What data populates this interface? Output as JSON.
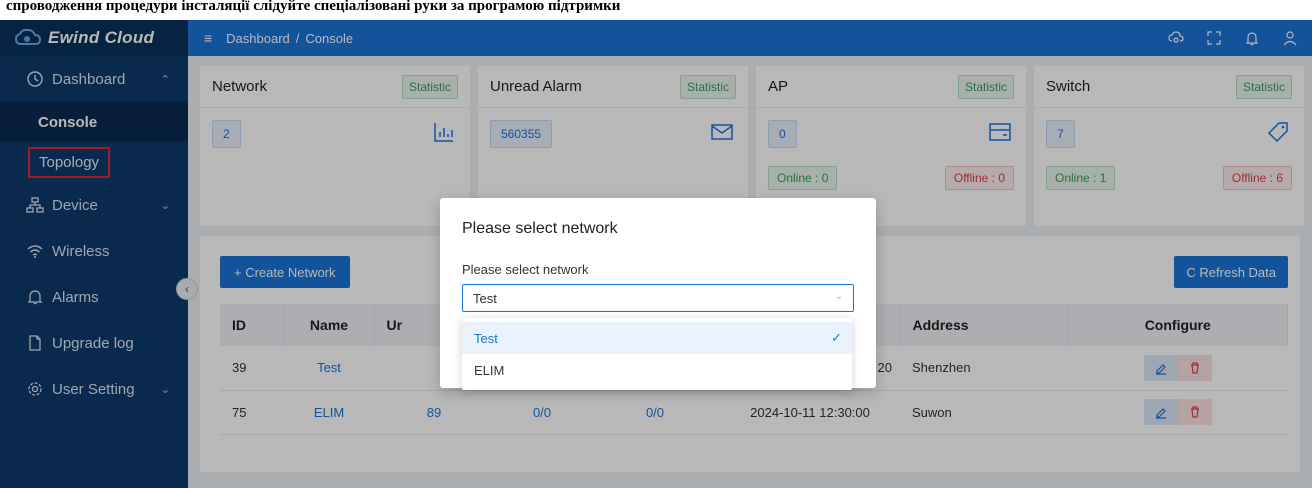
{
  "caption": "спроводження процедури інсталяції слідуйте спеціалізовані руки за програмою підтримки",
  "brand": {
    "name": "Ewind Cloud",
    "accent": "#1a73d9",
    "sidebar_bg": "#0d3a6b"
  },
  "breadcrumb": {
    "root": "Dashboard",
    "sep": "/",
    "current": "Console"
  },
  "sidebar": {
    "dashboard": "Dashboard",
    "console": "Console",
    "topology": "Topology",
    "device": "Device",
    "wireless": "Wireless",
    "alarms": "Alarms",
    "upgrade_log": "Upgrade log",
    "user_setting": "User Setting"
  },
  "cards": [
    {
      "title": "Network",
      "badge": "Statistic",
      "value": "2"
    },
    {
      "title": "Unread Alarm",
      "badge": "Statistic",
      "value": "560355"
    },
    {
      "title": "AP",
      "badge": "Statistic",
      "value": "0",
      "online": "Online : 0",
      "offline": "Offline : 0"
    },
    {
      "title": "Switch",
      "badge": "Statistic",
      "value": "7",
      "online": "Online : 1",
      "offline": "Offline : 6"
    }
  ],
  "toolbar": {
    "create": "+ Create Network",
    "refresh": "C Refresh Data"
  },
  "table": {
    "headers": {
      "id": "ID",
      "name": "Name",
      "unread": "Ur",
      "address": "Address",
      "configure": "Configure"
    },
    "rows": [
      {
        "id": "39",
        "name": "Test",
        "date_tail": "20",
        "address": "Shenzhen"
      },
      {
        "id": "75",
        "name": "ELIM",
        "unread": "89",
        "ap": "0/0",
        "sw": "0/0",
        "date": "2024-10-11 12:30:00",
        "address": "Suwon"
      }
    ]
  },
  "modal": {
    "title": "Please select network",
    "label": "Please select network",
    "selected": "Test",
    "options": [
      "Test",
      "ELIM"
    ]
  }
}
